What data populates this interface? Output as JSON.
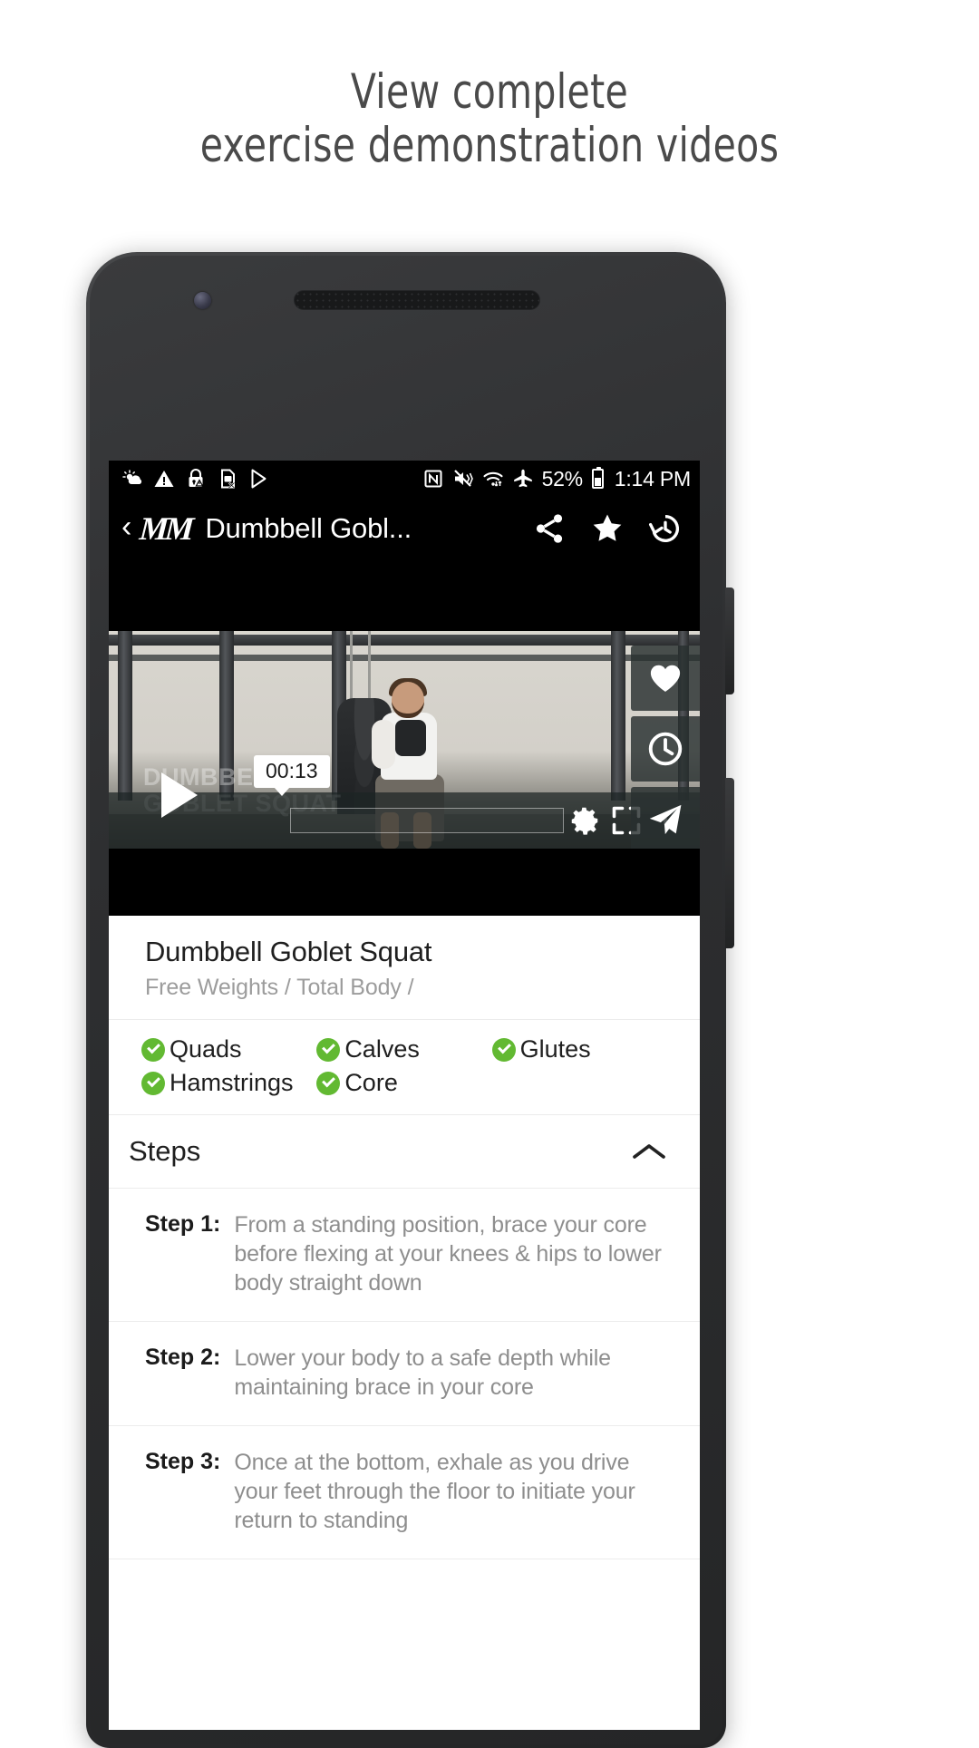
{
  "promo": {
    "line1": "View complete",
    "line2": "exercise demonstration videos"
  },
  "phone": {
    "statusbar": {
      "left_icons": [
        "weather-partly-sunny-icon",
        "warning-triangle-icon",
        "lock-warning-icon",
        "sim-card-error-icon",
        "play-store-icon"
      ],
      "right_icons": [
        "nfc-icon",
        "mute-vibrate-icon",
        "wifi-transfer-icon",
        "airplane-mode-icon"
      ],
      "battery_percent": "52%",
      "battery_icon": "battery-icon",
      "time": "1:14 PM"
    },
    "appbar": {
      "back_icon": "back-chevron-icon",
      "logo": "MM",
      "title": "Dumbbell Gobl...",
      "share_icon": "share-icon",
      "favorite_icon": "star-icon",
      "history_icon": "history-clock-icon"
    },
    "video": {
      "overlay_title_line1": "DUMBBELL",
      "overlay_title_line2": "GOBLET SQUAT",
      "play_icon": "play-icon",
      "current_time": "00:13",
      "settings_icon": "gear-icon",
      "fullscreen_icon": "fullscreen-icon",
      "provider_icon": "vimeo-icon",
      "actions": [
        {
          "name": "favorite-heart-icon"
        },
        {
          "name": "add-to-history-clock-icon"
        },
        {
          "name": "send-paper-plane-icon"
        }
      ]
    },
    "exercise": {
      "name": "Dumbbell Goblet Squat",
      "breadcrumb": "Free Weights / Total Body /",
      "muscles": [
        "Quads",
        "Calves",
        "Glutes",
        "Hamstrings",
        "Core"
      ],
      "check_color": "#62b932"
    },
    "steps_section": {
      "heading": "Steps",
      "collapse_icon": "chevron-up-icon",
      "steps": [
        {
          "label": "Step 1:",
          "text": "From a standing position, brace your core before flexing at your knees & hips to lower body straight down"
        },
        {
          "label": "Step 2:",
          "text": "Lower your body to a safe depth while maintaining brace in your core"
        },
        {
          "label": "Step 3:",
          "text": "Once at the bottom, exhale as you drive your feet through the floor to initiate your return to standing"
        }
      ]
    }
  }
}
